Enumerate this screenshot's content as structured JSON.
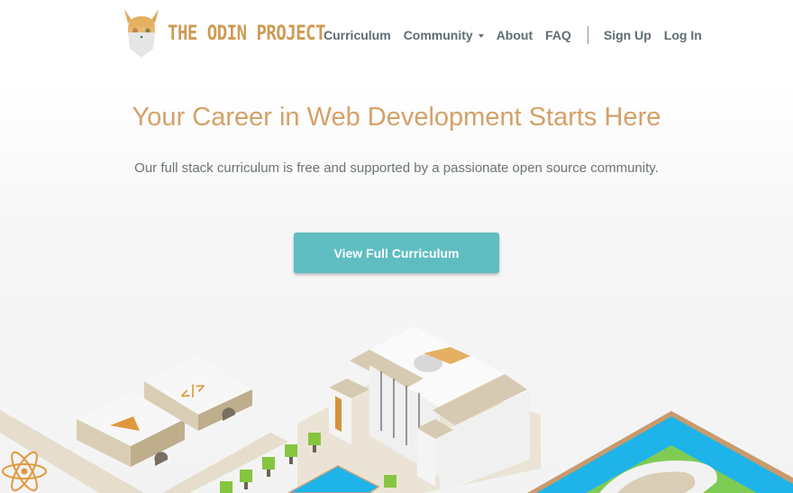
{
  "brand": {
    "name": "THE ODIN PROJECT",
    "logo_icon": "odin-viking-head-icon",
    "accent": "#ce9b54"
  },
  "nav": {
    "items": [
      {
        "label": "Curriculum"
      },
      {
        "label": "Community",
        "has_dropdown": true
      },
      {
        "label": "About"
      },
      {
        "label": "FAQ"
      }
    ],
    "auth": [
      {
        "label": "Sign Up"
      },
      {
        "label": "Log In"
      }
    ]
  },
  "hero": {
    "title": "Your Career in Web Development Starts Here",
    "subtitle": "Our full stack curriculum is free and supported by a passionate open source community.",
    "cta_label": "View Full Curriculum",
    "cta_color": "#5fbdc1"
  },
  "illustration": {
    "description": "isometric campus",
    "icons": [
      "atom-react-icon",
      "angular-triangle-icon",
      "code-brackets-icon",
      "odin-head-icon",
      "colosseum-icon",
      "tree-icon",
      "pool-icon"
    ]
  }
}
